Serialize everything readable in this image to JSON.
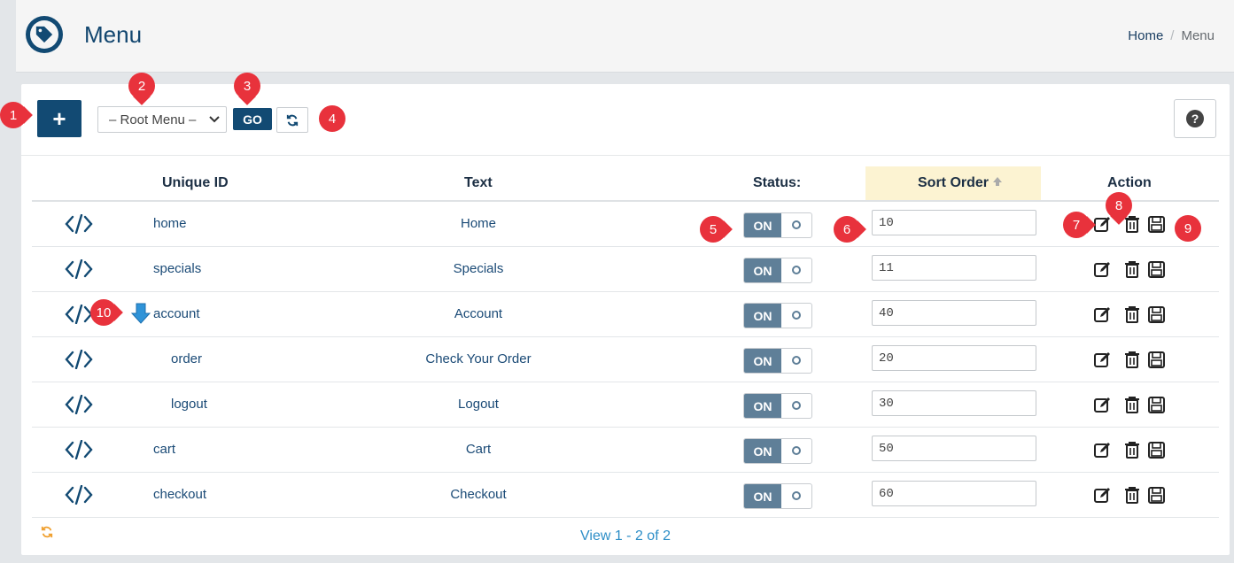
{
  "header": {
    "title": "Menu",
    "icon": "tag-icon",
    "breadcrumb": {
      "home": "Home",
      "current": "Menu"
    }
  },
  "toolbar": {
    "add_label": "+",
    "menu_select_value": "– Root Menu –",
    "go_label": "GO",
    "help_label": "?"
  },
  "table": {
    "headers": {
      "unique_id": "Unique ID",
      "text": "Text",
      "status": "Status:",
      "sort_order": "Sort Order",
      "action": "Action"
    },
    "rows": [
      {
        "uid": "home",
        "text": "Home",
        "status": "ON",
        "sort": "10",
        "indent": 0,
        "has_children": false
      },
      {
        "uid": "specials",
        "text": "Specials",
        "status": "ON",
        "sort": "11",
        "indent": 0,
        "has_children": false
      },
      {
        "uid": "account",
        "text": "Account",
        "status": "ON",
        "sort": "40",
        "indent": 0,
        "has_children": true
      },
      {
        "uid": "order",
        "text": "Check Your Order",
        "status": "ON",
        "sort": "20",
        "indent": 1,
        "has_children": false
      },
      {
        "uid": "logout",
        "text": "Logout",
        "status": "ON",
        "sort": "30",
        "indent": 1,
        "has_children": false
      },
      {
        "uid": "cart",
        "text": "Cart",
        "status": "ON",
        "sort": "50",
        "indent": 0,
        "has_children": false
      },
      {
        "uid": "checkout",
        "text": "Checkout",
        "status": "ON",
        "sort": "60",
        "indent": 0,
        "has_children": false
      }
    ]
  },
  "footer": {
    "pager": "View 1 - 2 of 2"
  },
  "callouts": [
    "1",
    "2",
    "3",
    "4",
    "5",
    "6",
    "7",
    "8",
    "9",
    "10"
  ],
  "colors": {
    "primary": "#124a73",
    "toggle_on": "#5f7f98",
    "callout": "#e8323c",
    "sort_highlight": "#fcf3d2",
    "link": "#2d8ec7"
  }
}
